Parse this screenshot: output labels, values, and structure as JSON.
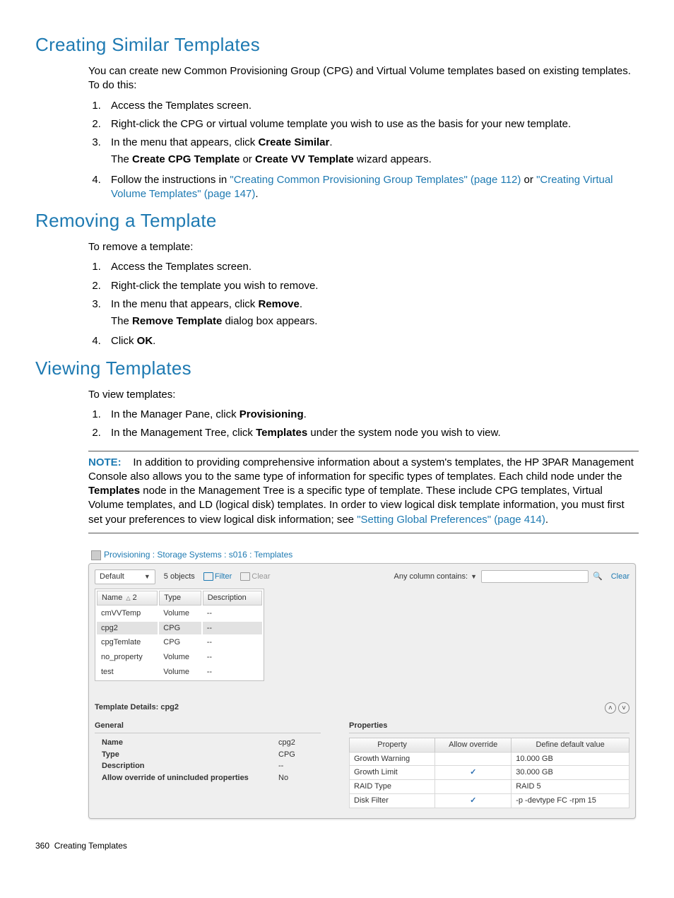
{
  "sections": {
    "creating": {
      "title": "Creating Similar Templates",
      "intro": "You can create new Common Provisioning Group (CPG) and Virtual Volume templates based on existing templates. To do this:",
      "steps": {
        "s1": "Access the Templates screen.",
        "s2": "Right-click the CPG or virtual volume template you wish to use as the basis for your new template.",
        "s3_pre": "In the menu that appears, click ",
        "s3_bold": "Create Similar",
        "s3_post": ".",
        "s3_sub_pre": "The ",
        "s3_sub_b1": "Create CPG Template",
        "s3_sub_mid": " or ",
        "s3_sub_b2": "Create VV Template",
        "s3_sub_post": " wizard appears.",
        "s4_pre": "Follow the instructions in ",
        "s4_link1": "\"Creating Common Provisioning Group Templates\" (page 112)",
        "s4_mid": " or ",
        "s4_link2": "\"Creating Virtual Volume Templates\" (page 147)",
        "s4_post": "."
      }
    },
    "removing": {
      "title": "Removing a Template",
      "intro": "To remove a template:",
      "steps": {
        "s1": "Access the Templates screen.",
        "s2": "Right-click the template you wish to remove.",
        "s3_pre": "In the menu that appears, click ",
        "s3_bold": "Remove",
        "s3_post": ".",
        "s3_sub_pre": "The ",
        "s3_sub_b": "Remove Template",
        "s3_sub_post": " dialog box appears.",
        "s4_pre": "Click ",
        "s4_bold": "OK",
        "s4_post": "."
      }
    },
    "viewing": {
      "title": "Viewing Templates",
      "intro": "To view templates:",
      "steps": {
        "s1_pre": "In the Manager Pane, click ",
        "s1_bold": "Provisioning",
        "s1_post": ".",
        "s2_pre": "In the Management Tree, click ",
        "s2_bold": "Templates",
        "s2_post": " under the system node you wish to view."
      }
    }
  },
  "note": {
    "label": "NOTE:",
    "pre": "In addition to providing comprehensive information about a system's templates, the HP 3PAR Management Console also allows you to the same type of information for specific types of templates. Each child node under the ",
    "bold": "Templates",
    "mid": " node in the Management Tree is a specific type of template. These include CPG templates, Virtual Volume templates, and LD (logical disk) templates. In order to view logical disk template information, you must first set your preferences to view logical disk information; see ",
    "link": "\"Setting Global Preferences\" (page 414)",
    "post": "."
  },
  "screenshot": {
    "title": "Provisioning : Storage Systems : s016 : Templates",
    "dropdown": "Default",
    "objects": "5 objects",
    "filter": "Filter",
    "clear_disabled": "Clear",
    "anycol": "Any column contains:",
    "clear": "Clear",
    "cols": {
      "name": "Name",
      "sort": "2",
      "type": "Type",
      "desc": "Description"
    },
    "rows": [
      {
        "name": "cmVVTemp",
        "type": "Volume",
        "desc": "--"
      },
      {
        "name": "cpg2",
        "type": "CPG",
        "desc": "--"
      },
      {
        "name": "cpgTemlate",
        "type": "CPG",
        "desc": "--"
      },
      {
        "name": "no_property",
        "type": "Volume",
        "desc": "--"
      },
      {
        "name": "test",
        "type": "Volume",
        "desc": "--"
      }
    ],
    "details_title": "Template Details: cpg2",
    "general_tab": "General",
    "general": {
      "name_k": "Name",
      "name_v": "cpg2",
      "type_k": "Type",
      "type_v": "CPG",
      "desc_k": "Description",
      "desc_v": "--",
      "allow_k": "Allow override of unincluded properties",
      "allow_v": "No"
    },
    "properties_tab": "Properties",
    "prop_cols": {
      "prop": "Property",
      "allow": "Allow override",
      "def": "Define default value"
    },
    "props": [
      {
        "p": "Growth Warning",
        "a": "",
        "d": "10.000 GB"
      },
      {
        "p": "Growth Limit",
        "a": "✓",
        "d": "30.000 GB"
      },
      {
        "p": "RAID Type",
        "a": "",
        "d": "RAID 5"
      },
      {
        "p": "Disk Filter",
        "a": "✓",
        "d": "-p -devtype FC -rpm 15"
      }
    ]
  },
  "footer": {
    "page": "360",
    "title": "Creating Templates"
  }
}
